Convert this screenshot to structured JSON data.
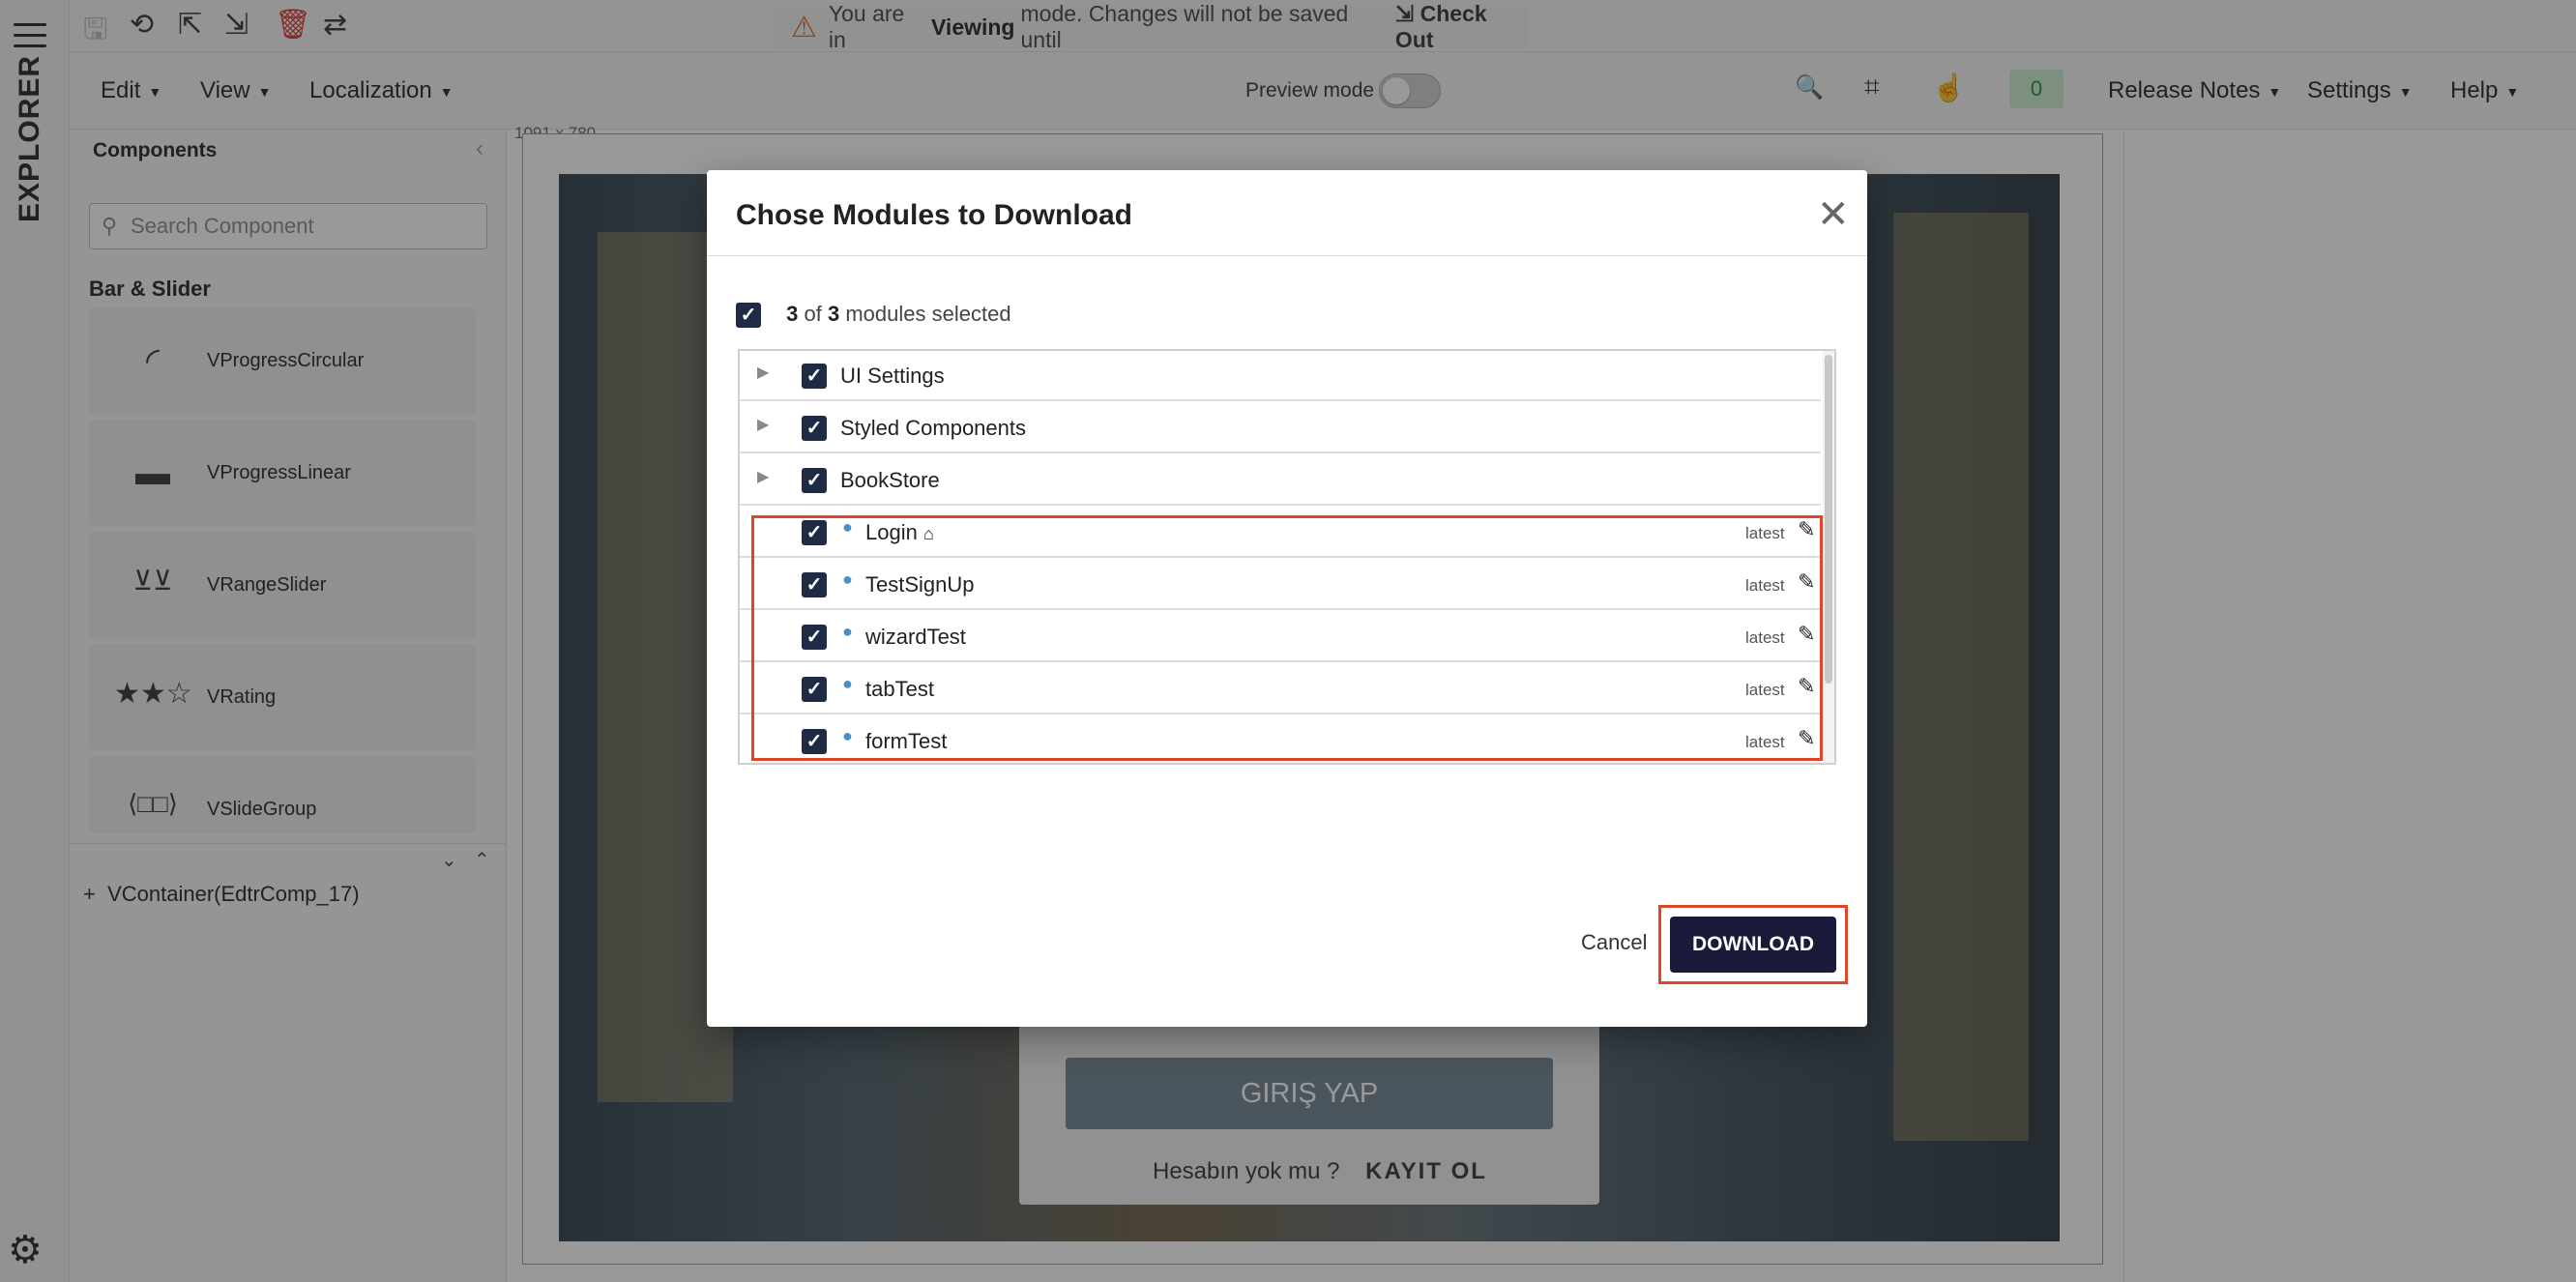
{
  "rail": {
    "title": "EXPLORER"
  },
  "banner": {
    "prefix": "You are in",
    "mode": "Viewing",
    "suffix": "mode. Changes will not be saved until",
    "checkout": "Check Out"
  },
  "menubar": {
    "edit": "Edit",
    "view": "View",
    "localization": "Localization",
    "preview_label": "Preview mode",
    "counter": "0",
    "release_notes": "Release Notes",
    "settings": "Settings",
    "help": "Help"
  },
  "panel": {
    "title": "Components",
    "search_placeholder": "Search Component",
    "category": "Bar & Slider",
    "items": [
      {
        "label": "VProgressCircular",
        "icon": "progress-circular-icon"
      },
      {
        "label": "VProgressLinear",
        "icon": "progress-linear-icon"
      },
      {
        "label": "VRangeSlider",
        "icon": "range-slider-icon"
      },
      {
        "label": "VRating",
        "icon": "rating-icon"
      },
      {
        "label": "VSlideGroup",
        "icon": "slide-group-icon"
      }
    ],
    "tree_node": "VContainer(EdtrComp_17)"
  },
  "canvas": {
    "dimensions": "1091 x 780",
    "login_button": "GIRIŞ YAP",
    "no_account": "Hesabın yok mu ?",
    "register": "KAYIT OL"
  },
  "dialog": {
    "title": "Chose Modules to Download",
    "selected_count": "3",
    "of": "of",
    "total_count": "3",
    "selected_suffix": "modules selected",
    "groups": [
      {
        "label": "UI Settings"
      },
      {
        "label": "Styled Components"
      },
      {
        "label": "BookStore"
      }
    ],
    "modules": [
      {
        "label": "Login",
        "version": "latest"
      },
      {
        "label": "TestSignUp",
        "version": "latest"
      },
      {
        "label": "wizardTest",
        "version": "latest"
      },
      {
        "label": "tabTest",
        "version": "latest"
      },
      {
        "label": "formTest",
        "version": "latest"
      }
    ],
    "cancel": "Cancel",
    "download": "DOWNLOAD"
  },
  "colors": {
    "primary": "#1a1a3a",
    "highlight": "#e0442a",
    "warning": "#e06a1a"
  }
}
